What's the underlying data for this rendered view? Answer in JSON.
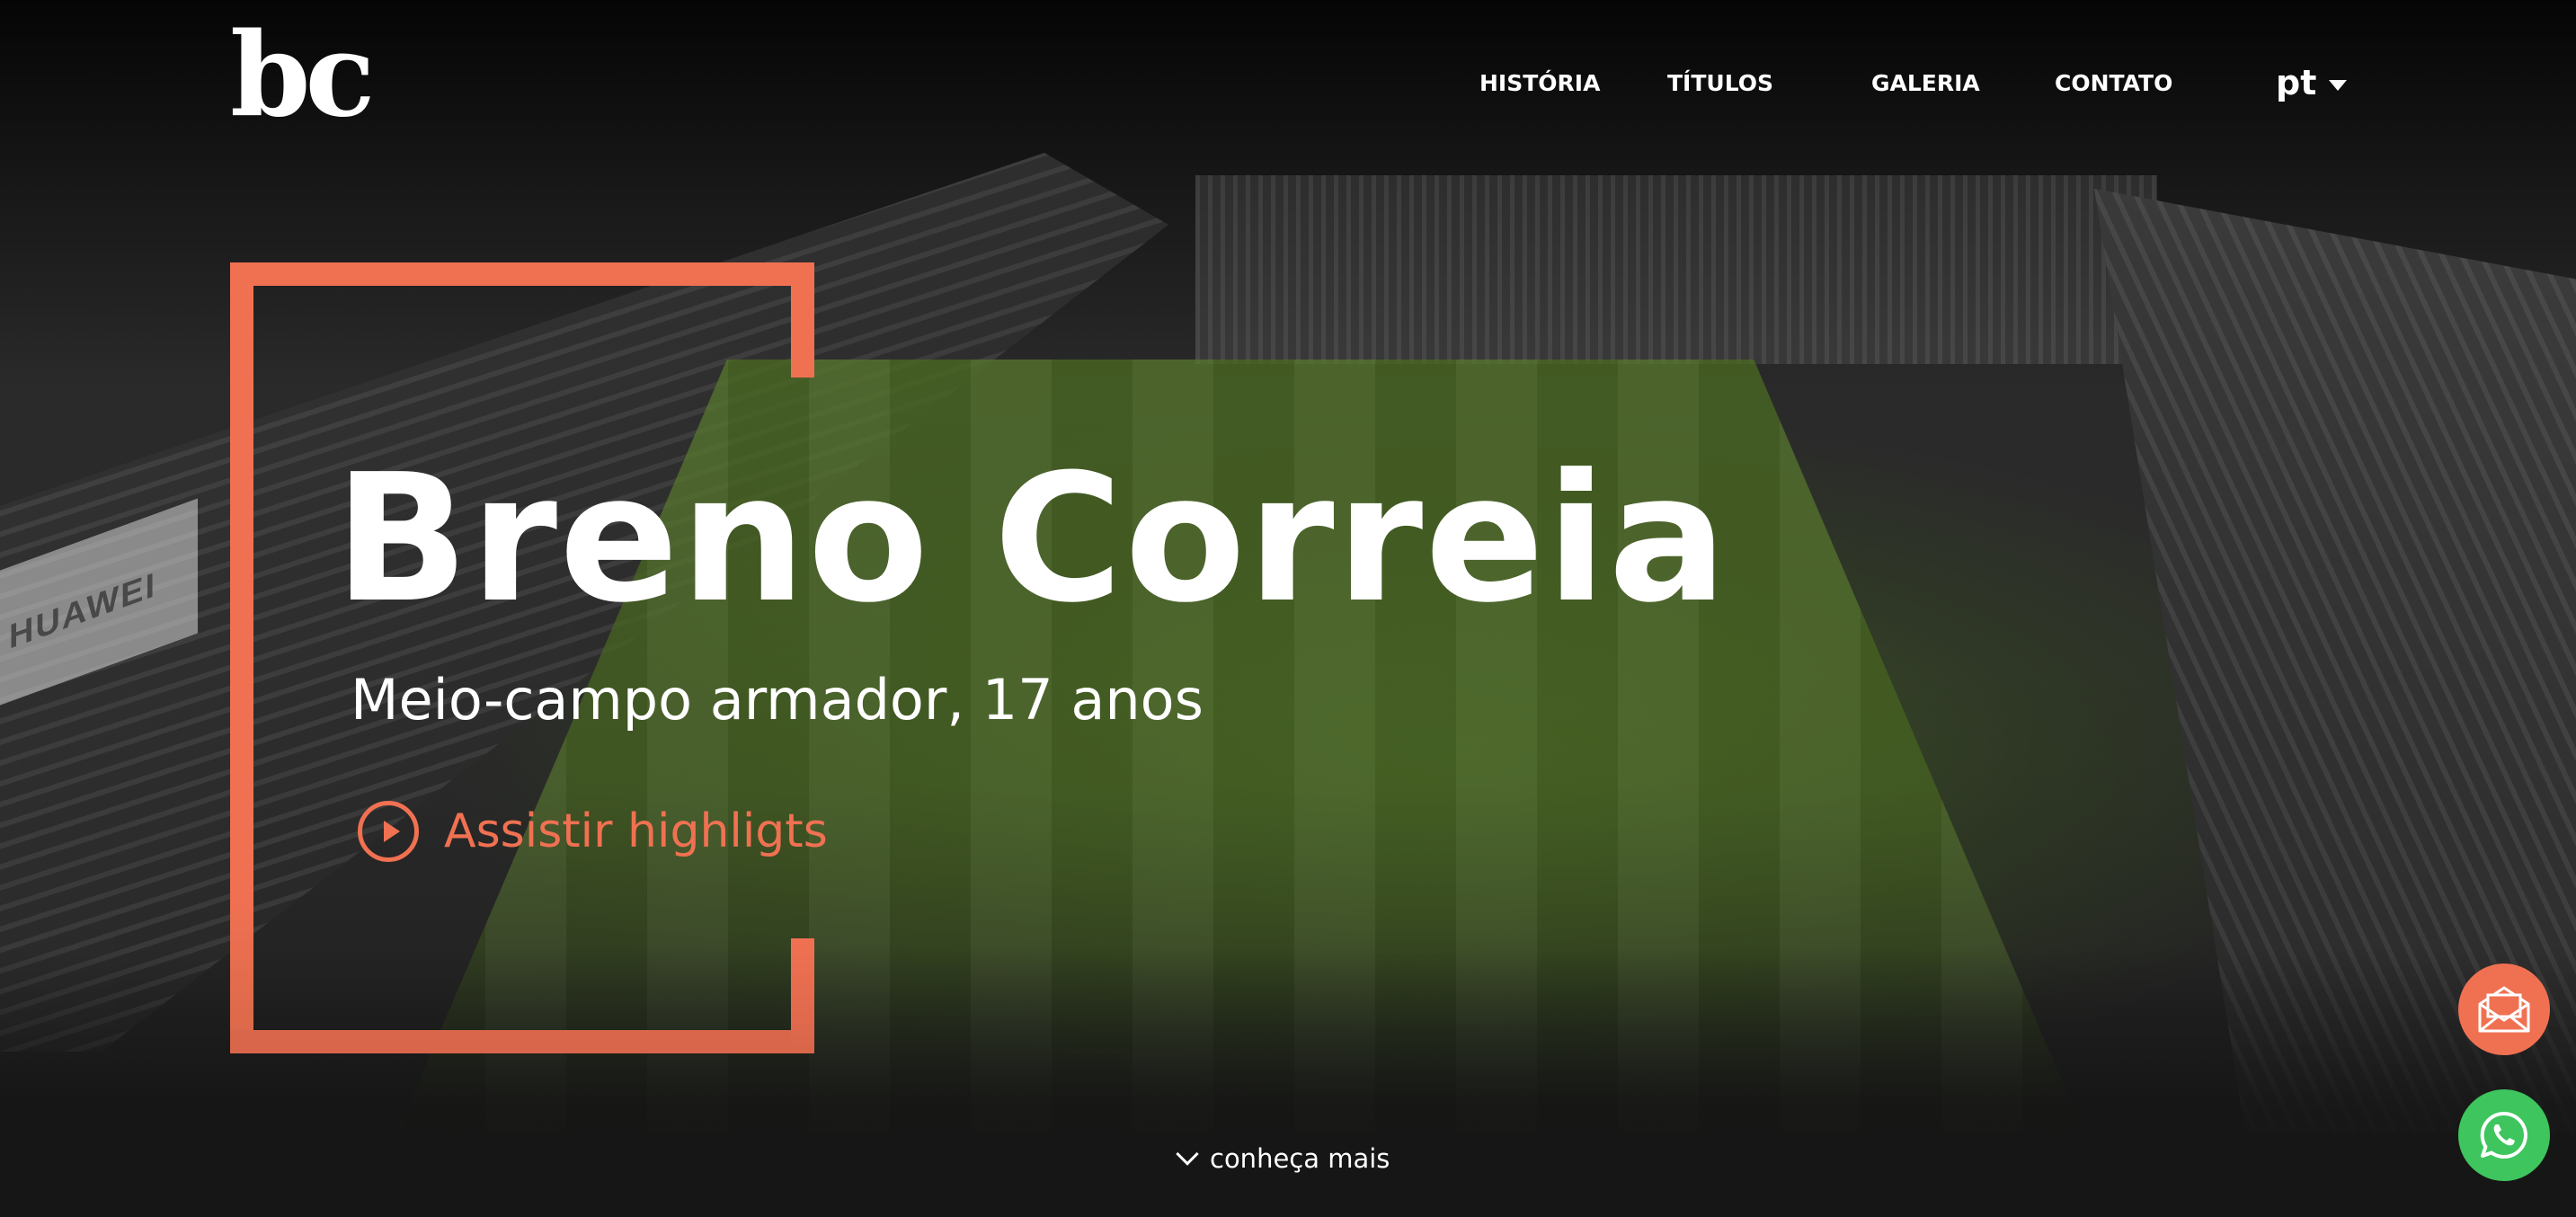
{
  "header": {
    "logo": "bc",
    "nav": [
      {
        "label": "HISTÓRIA"
      },
      {
        "label": "TÍTULOS"
      },
      {
        "label": "GALERIA"
      },
      {
        "label": "CONTATO"
      }
    ],
    "language": "pt"
  },
  "hero": {
    "name": "Breno Correia",
    "subtitle": "Meio-campo armador, 17 anos",
    "cta_label": "Assistir highligts",
    "background_sign": "HUAWEI",
    "scroll_hint": "conheça mais"
  },
  "floating_buttons": [
    {
      "icon": "envelope-open-icon",
      "color": "#f07152"
    },
    {
      "icon": "whatsapp-icon",
      "color": "#3ec55d"
    }
  ],
  "colors": {
    "accent": "#f07152",
    "text": "#ffffff",
    "whatsapp": "#3ec55d"
  }
}
